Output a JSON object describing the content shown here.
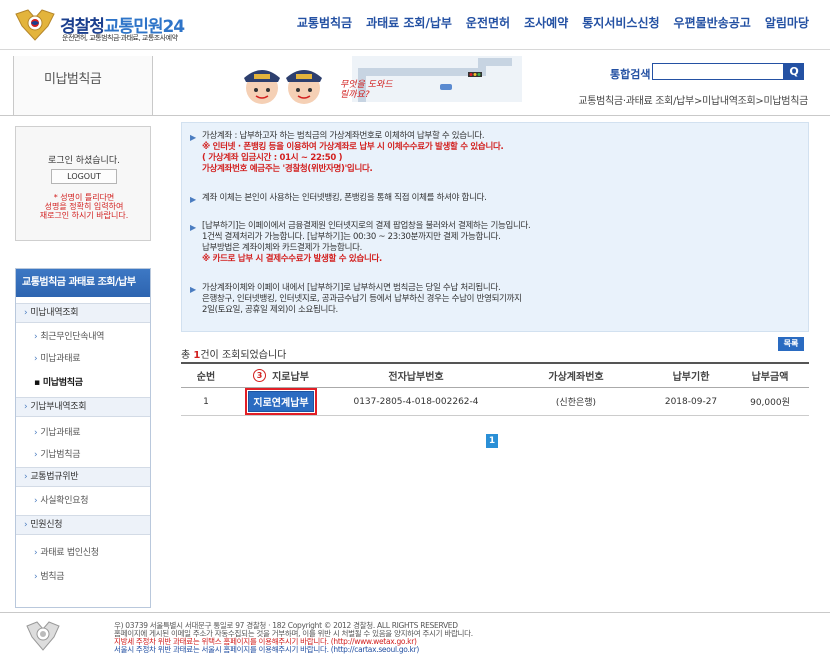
{
  "header": {
    "logo_title_part1": "경찰청",
    "logo_title_part2": "교통민원24",
    "logo_subtitle": "운전면허, 교통범칙금·과태료, 교통조사예약",
    "nav": [
      "교통범칙금",
      "과태료 조회/납부",
      "운전면허",
      "조사예약",
      "통지서비스신청",
      "우편물반송공고",
      "알림마당"
    ]
  },
  "subheader": {
    "page_title": "미납범칙금",
    "banner_speech": "무엇을 도와드릴까요?",
    "search_label": "통합검색",
    "search_value": "",
    "search_button": "Q",
    "breadcrumb": "교통범칙금·과태료 조회/납부>미납내역조회>미납범칙금"
  },
  "login": {
    "message": "로그인 하셨습니다.",
    "logout_label": "LOGOUT",
    "notice": [
      "* 성명이 틀리다면",
      "성명을 정확히 입력하여",
      "재로그인 하시기 바랍니다."
    ]
  },
  "sidenav": {
    "title": "교통범칙금 과태료 조회/납부",
    "items": [
      {
        "label": "미납내역조회",
        "type": "section"
      },
      {
        "label": "최근무인단속내역",
        "type": "sub"
      },
      {
        "label": "미납과태료",
        "type": "sub"
      },
      {
        "label": "미납범칙금",
        "type": "sub-active"
      },
      {
        "label": "기납부내역조회",
        "type": "section"
      },
      {
        "label": "기납과태료",
        "type": "sub"
      },
      {
        "label": "기납범칙금",
        "type": "sub"
      },
      {
        "label": "교통법규위반",
        "type": "section"
      },
      {
        "label": "사실확인요청",
        "type": "sub"
      },
      {
        "label": "민원신청",
        "type": "section"
      },
      {
        "label": "과태료 법인신청",
        "type": "sub"
      },
      {
        "label": "범칙금",
        "type": "sub"
      }
    ]
  },
  "info": {
    "b1_l1": "가상계좌 : 납부하고자 하는 범칙금의 가상계좌번호로 이체하여 납부할 수 있습니다.",
    "b1_l2": "※ 인터넷 · 폰뱅킹 등을 이용하여 가상계좌로 납부 시 이체수수료가 발생할 수 있습니다.",
    "b1_l3": "( 가상계좌 입금시간 : 01시 ~ 22:50 )",
    "b1_l4": "가상계좌번호 예금주는 '경찰청(위반자명)'입니다.",
    "b2_l1": "계좌 이체는 본인이 사용하는 인터넷뱅킹, 폰뱅킹을 통해 직접 이체를 하셔야 합니다.",
    "b3_l1": "[납부하기]는 이페이에서 금융결제원 인터넷지로의 결제 팝업창을 불러와서 결제하는 기능입니다.",
    "b3_l2": "1건씩 결제처리가 가능합니다. [납부하기]는 00:30 ~ 23:30분까지만 결제 가능합니다.",
    "b3_l3": "납부방법은 계좌이체와 카드결제가 가능합니다.",
    "b3_l4": "※ 카드로 납부 시 결제수수료가 발생할 수 있습니다.",
    "b4_l1": "가상계좌이체와 이페이 내에서 [납부하기]로 납부하시면 범칙금는 당일 수납 처리됩니다.",
    "b4_l2": "은행창구, 인터넷뱅킹, 인터넷지로, 공과금수납기 등에서 납부하신 경우는 수납이 반영되기까지",
    "b4_l3": "2일(토요일, 공휴일 제외)이 소요됩니다."
  },
  "list_button": "목록",
  "count": {
    "prefix": "총 ",
    "num": "1",
    "suffix": "건이 조회되었습니다"
  },
  "table": {
    "headers": [
      "순번",
      "지로납부",
      "전자납부번호",
      "가상계좌번호",
      "납부기한",
      "납부금액"
    ],
    "marker": "3",
    "rows": [
      {
        "no": "1",
        "pay_button": "지로연계납부",
        "epay_no": "0137-2805-4-018-002262-4",
        "vaccount": "(신한은행)",
        "due": "2018-09-27",
        "amount": "90,000원"
      }
    ]
  },
  "pagination": {
    "current": "1"
  },
  "footer": {
    "l1": "우) 03739 서울특별시 서대문구 통일로 97 경찰청 · 182    Copyright © 2012 경찰청. ALL RIGHTS RESERVED",
    "l2": "홈페이지에 게시된 이메일 주소가 자동수집되는 것을 거부하며, 이를 위반 시 처벌될 수 있음을 양지하여 주시기 바랍니다.",
    "l3": "지방세 주정차 위반 과태료는 위택스 홈페이지를 이용해주시기 바랍니다. (http://www.wetax.go.kr)",
    "l4": "서울시 주정차 위반 과태료는 서울시 홈페이지를 이용해주시기 바랍니다. (http://cartax.seoul.go.kr)"
  },
  "colors": {
    "brand": "#2451a3",
    "accent_red": "#d2201f",
    "info_bg": "#e9f2fb",
    "button_blue": "#2a6bc1"
  }
}
